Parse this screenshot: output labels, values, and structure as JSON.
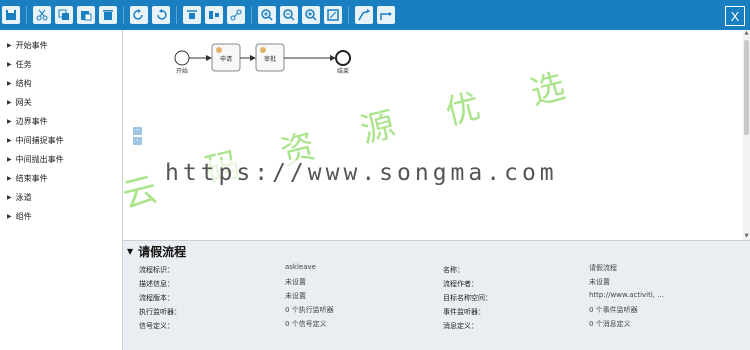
{
  "toolbar": {
    "buttons": [
      "save-icon",
      "cut-icon",
      "copy-icon",
      "paste-icon",
      "delete-icon",
      "redo-icon",
      "undo-icon",
      "align-top-icon",
      "align-middle-icon",
      "align-split-icon",
      "zoom-in-icon",
      "zoom-out-icon",
      "zoom-fit-icon",
      "fullscreen-icon",
      "route-icon",
      "route-alt-icon"
    ],
    "close_label": "X",
    "color": "#1a7fc1"
  },
  "sidebar": {
    "items": [
      {
        "label": "开始事件"
      },
      {
        "label": "任务"
      },
      {
        "label": "结构"
      },
      {
        "label": "网关"
      },
      {
        "label": "边界事件"
      },
      {
        "label": "中间捕捉事件"
      },
      {
        "label": "中间抛出事件"
      },
      {
        "label": "结束事件"
      },
      {
        "label": "泳道"
      },
      {
        "label": "组件"
      }
    ]
  },
  "diagram": {
    "start_label": "开始",
    "task1_label": "申请",
    "task2_label": "审批",
    "end_label": "结束"
  },
  "watermark": {
    "url": "https://www.songma.com",
    "cn": [
      "云",
      "码",
      "资",
      "源",
      "优",
      "选"
    ]
  },
  "props": {
    "title": "请假流程",
    "rows": [
      {
        "label": "流程标识：",
        "value": "askleave",
        "label2": "名称：",
        "value2": "请假流程"
      },
      {
        "label": "描述信息：",
        "value": "未设置",
        "label2": "流程作者：",
        "value2": "未设置"
      },
      {
        "label": "流程版本：",
        "value": "未设置",
        "label2": "目标名称空间：",
        "value2": "http://www.activiti, ..."
      },
      {
        "label": "执行监听器：",
        "value": "0 个执行监听器",
        "label2": "事件监听器：",
        "value2": "0 个事件监听器"
      },
      {
        "label": "信号定义：",
        "value": "0 个信号定义",
        "label2": "消息定义：",
        "value2": "0 个消息定义"
      }
    ]
  }
}
